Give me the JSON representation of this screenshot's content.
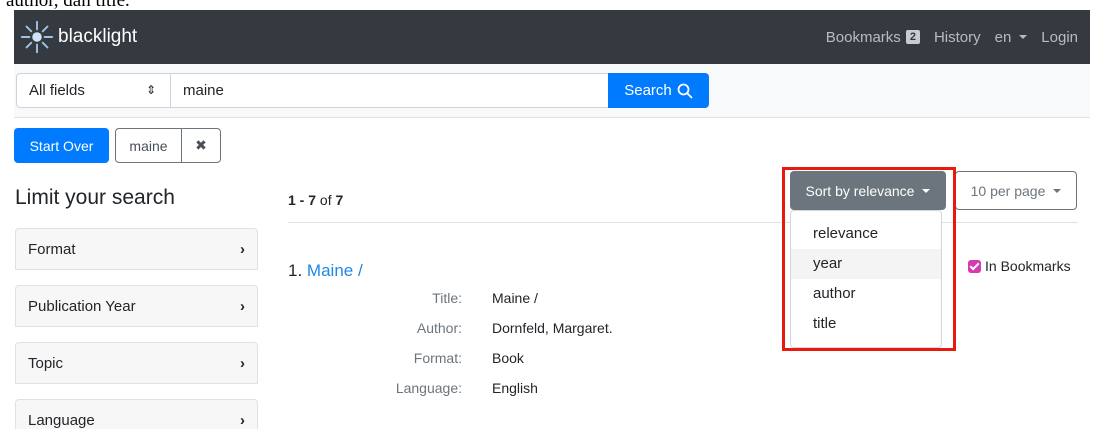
{
  "caption": "author, dan title.",
  "header": {
    "brand": "blacklight",
    "bookmarks_label": "Bookmarks",
    "bookmarks_count": "2",
    "history_label": "History",
    "language": "en",
    "login_label": "Login"
  },
  "search": {
    "field": "All fields",
    "query": "maine",
    "button_label": "Search"
  },
  "constraints": {
    "start_over": "Start Over",
    "active_value": "maine",
    "remove_symbol": "✖"
  },
  "sidebar": {
    "title": "Limit your search",
    "facets": [
      {
        "label": "Format"
      },
      {
        "label": "Publication Year"
      },
      {
        "label": "Topic"
      },
      {
        "label": "Language"
      }
    ]
  },
  "results": {
    "range": "1 - 7",
    "of": "of",
    "total": "7"
  },
  "sort": {
    "button_label": "Sort by relevance",
    "options": [
      "relevance",
      "year",
      "author",
      "title"
    ],
    "hovered_option": "year"
  },
  "per_page": {
    "label": "10 per page"
  },
  "document": {
    "number": "1.",
    "title": "Maine /",
    "bookmark_label": "In Bookmarks",
    "fields": [
      {
        "label": "Title:",
        "value": "Maine /"
      },
      {
        "label": "Author:",
        "value": "Dornfeld, Margaret."
      },
      {
        "label": "Format:",
        "value": "Book"
      },
      {
        "label": "Language:",
        "value": "English"
      }
    ]
  },
  "colors": {
    "navbar": "#343a40",
    "primary": "#007bff",
    "secondary": "#6c757d",
    "link": "#1e88e5",
    "annotation": "#e8190e",
    "bookmark_check": "#d63ab1"
  },
  "icons": {
    "logo": "blacklight-logo-icon",
    "search": "magnifier-icon",
    "facet_toggle": "chevron-right-icon"
  }
}
